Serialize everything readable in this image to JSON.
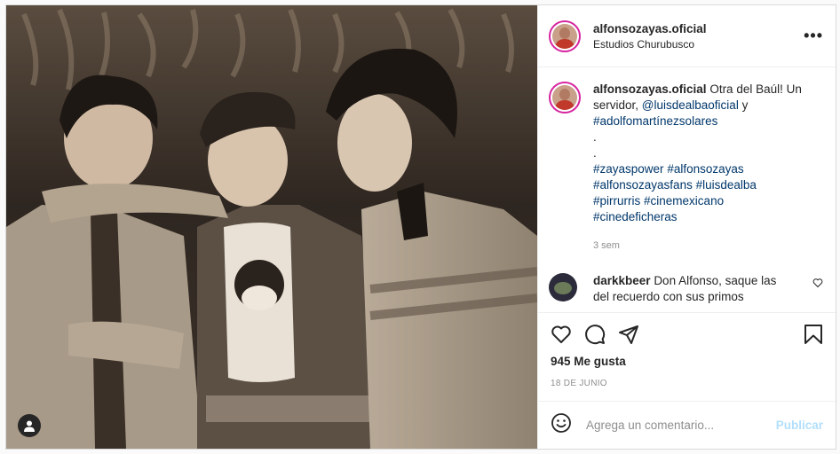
{
  "post": {
    "username": "alfonsozayas.oficial",
    "location": "Estudios Churubusco",
    "more_label": "•••",
    "caption": {
      "username": "alfonsozayas.oficial",
      "text_1": "Otra del Baúl! Un servidor,",
      "mention_1": "@luisdealbaoficial",
      "text_2": "y",
      "hashtag_1": "#adolfomartínezsolares",
      "dot_1": ".",
      "dot_2": ".",
      "hashtags": [
        "#zayaspower",
        "#alfonsozayas",
        "#alfonsozayasfans",
        "#luisdealba",
        "#pirrurris",
        "#cinemexicano",
        "#cinedeficheras"
      ]
    },
    "caption_time": "3 sem",
    "comment": {
      "username": "darkkbeer",
      "text": "Don Alfonso, saque las del recuerdo con sus primos"
    },
    "likes": "945 Me gusta",
    "date": "18 DE JUNIO",
    "add_comment": {
      "placeholder": "Agrega un comentario...",
      "publish_label": "Publicar"
    }
  },
  "icons": {
    "heart": "heart-icon",
    "comment": "comment-icon",
    "share": "share-icon",
    "save": "bookmark-icon",
    "emoji": "emoji-icon",
    "tag": "user-tag-icon"
  },
  "colors": {
    "link": "#00376b",
    "muted": "#8e8e8e",
    "publish_disabled": "#b2dffc",
    "story_ring": "#d6249f"
  }
}
